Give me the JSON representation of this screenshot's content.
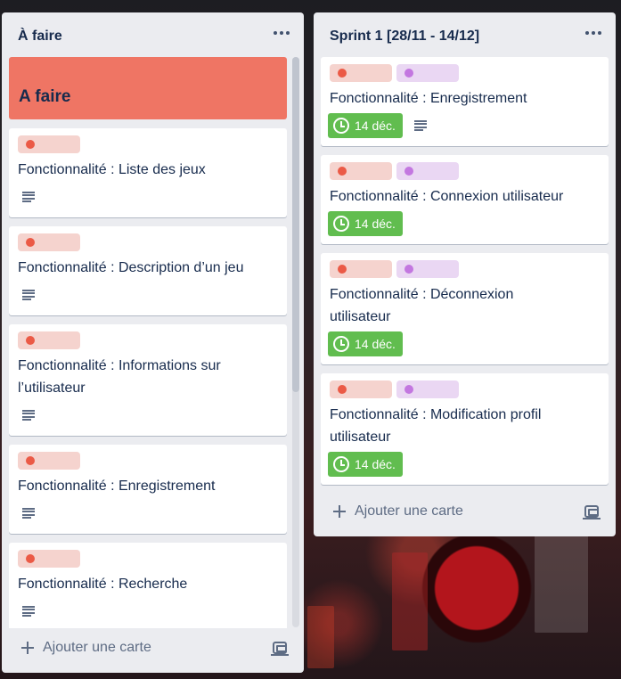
{
  "colors": {
    "list_bg": "#ebecf0",
    "cover_accent": "#ef7564",
    "label_red": "#eb5a46",
    "label_purple": "#c377e0",
    "due_green": "#61bd4f",
    "text": "#172b4d"
  },
  "lists": [
    {
      "title": "À faire",
      "menu_icon": "ellipsis-icon",
      "cover_card": {
        "title": "A faire"
      },
      "cards": [
        {
          "title": "Fonctionnalité : Liste des jeux",
          "labels": [
            "red"
          ],
          "badge": "description-icon"
        },
        {
          "title": "Fonctionnalité : Description d’un jeu",
          "labels": [
            "red"
          ],
          "badge": "description-icon"
        },
        {
          "title_line1": "Fonctionnalité : Informations sur",
          "title_line2": "l’utilisateur",
          "labels": [
            "red"
          ],
          "badge": "description-icon"
        },
        {
          "title": "Fonctionnalité : Enregistrement",
          "labels": [
            "red"
          ],
          "badge": "description-icon"
        },
        {
          "title": "Fonctionnalité : Recherche",
          "labels": [
            "red"
          ],
          "badge": "description-icon"
        }
      ],
      "add_card_label": "Ajouter une carte",
      "template_icon": "card-template-icon"
    },
    {
      "title": "Sprint 1 [28/11 - 14/12]",
      "menu_icon": "ellipsis-icon",
      "cards": [
        {
          "title": "Fonctionnalité : Enregistrement",
          "labels": [
            "red",
            "purple"
          ],
          "due": "14 déc."
        },
        {
          "title": "Fonctionnalité : Connexion utilisateur",
          "labels": [
            "red",
            "purple"
          ],
          "due": "14 déc."
        },
        {
          "title_line1": "Fonctionnalité : Déconnexion",
          "title_line2": "utilisateur",
          "labels": [
            "red",
            "purple"
          ],
          "due": "14 déc."
        },
        {
          "title_line1": "Fonctionnalité : Modification profil",
          "title_line2": "utilisateur",
          "labels": [
            "red",
            "purple"
          ],
          "due": "14 déc."
        }
      ],
      "add_card_label": "Ajouter une carte",
      "template_icon": "card-template-icon"
    }
  ]
}
